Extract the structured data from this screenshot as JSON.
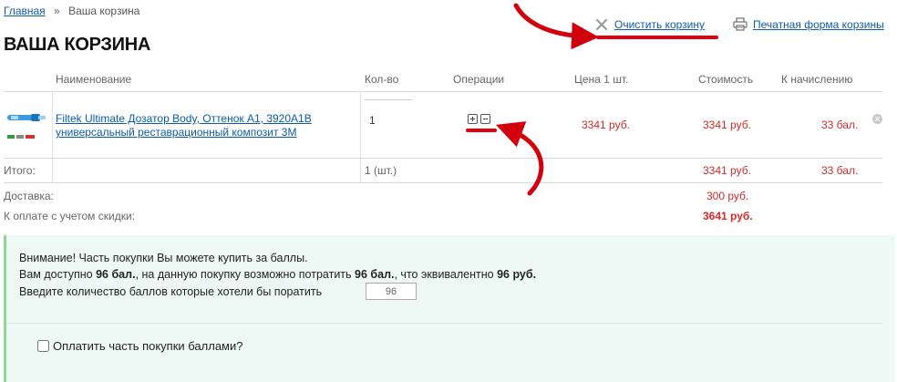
{
  "breadcrumb": {
    "home": "Главная",
    "separator": "»",
    "current": "Ваша корзина"
  },
  "page_title": "ВАША КОРЗИНА",
  "actions": {
    "clear_cart": "Очистить корзину",
    "print_form": "Печатная форма корзины"
  },
  "table": {
    "headers": {
      "name": "Наименование",
      "qty": "Кол-во",
      "operations": "Операции",
      "unit_price": "Цена 1 шт.",
      "cost": "Стоимость",
      "points": "К начислению"
    },
    "items": [
      {
        "name_line1": "Filtek Ultimate Дозатор Body, Оттенок А1, 3920А1В",
        "name_line2": "универсальный реставрационный композит 3М",
        "qty": "1",
        "unit_price": "3341 руб.",
        "cost": "3341 руб.",
        "points": "33 бал."
      }
    ]
  },
  "totals": {
    "label": "Итого:",
    "qty": "1 (шт.)",
    "cost": "3341 руб.",
    "points": "33 бал.",
    "delivery_label": "Доставка:",
    "delivery_value": "300  руб.",
    "to_pay_label": "К оплате с учетом скидки:",
    "to_pay_value": "3641 руб."
  },
  "bonus": {
    "line1": "Внимание! Часть покупки Вы можете купить за баллы.",
    "line2_a": "Вам доступно ",
    "line2_b": "96 бал.",
    "line2_c": ", на данную покупку возможно потратить ",
    "line2_d": "96 бал.",
    "line2_e": ", что эквивалентно ",
    "line2_f": "96 руб.",
    "line3": "Введите количество баллов которые хотели бы поратить",
    "input_value": "96",
    "checkbox_label": "Оплатить часть покупки баллами?"
  },
  "colors": {
    "link": "#0b5cad",
    "price": "#d22a2a",
    "annotation": "#e3000f",
    "panel_bg": "#eef9f6",
    "panel_border": "#8fd88f"
  },
  "icons": {
    "clear": "close-icon",
    "print": "printer-icon",
    "remove": "remove-circle-icon"
  }
}
